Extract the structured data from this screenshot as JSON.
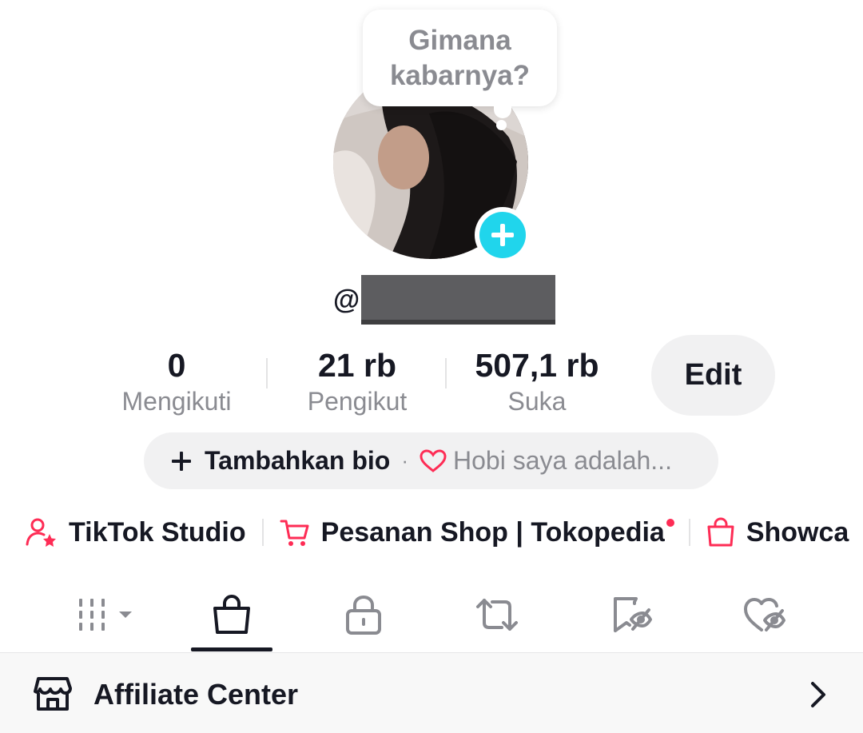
{
  "profile": {
    "bubble_text": "Gimana kabarnya?",
    "username_prefix": "@",
    "avatar_add_icon": "plus-icon"
  },
  "stats": [
    {
      "value": "0",
      "label": "Mengikuti"
    },
    {
      "value": "21 rb",
      "label": "Pengikut"
    },
    {
      "value": "507,1 rb",
      "label": "Suka"
    }
  ],
  "edit_label": "Edit",
  "bio": {
    "add_label": "Tambahkan bio",
    "separator": "·",
    "hint": "Hobi saya adalah..."
  },
  "links": [
    {
      "label": "TikTok Studio",
      "icon": "person-star-icon"
    },
    {
      "label": "Pesanan Shop | Tokopedia",
      "icon": "cart-icon",
      "badge": true
    },
    {
      "label": "Showca",
      "icon": "shopping-bag-icon"
    }
  ],
  "tabs": [
    {
      "icon": "grid-icon",
      "selected": false
    },
    {
      "icon": "shopping-bag-icon",
      "selected": true
    },
    {
      "icon": "lock-icon",
      "selected": false
    },
    {
      "icon": "repost-icon",
      "selected": false
    },
    {
      "icon": "bookmark-hidden-icon",
      "selected": false
    },
    {
      "icon": "heart-hidden-icon",
      "selected": false
    }
  ],
  "affiliate": {
    "label": "Affiliate Center",
    "icon": "store-icon"
  },
  "colors": {
    "accent_red": "#fe2c55",
    "accent_cyan": "#20d5ec",
    "text_primary": "#161823",
    "text_secondary": "#8a8b91",
    "pill_bg": "#f1f1f2"
  }
}
